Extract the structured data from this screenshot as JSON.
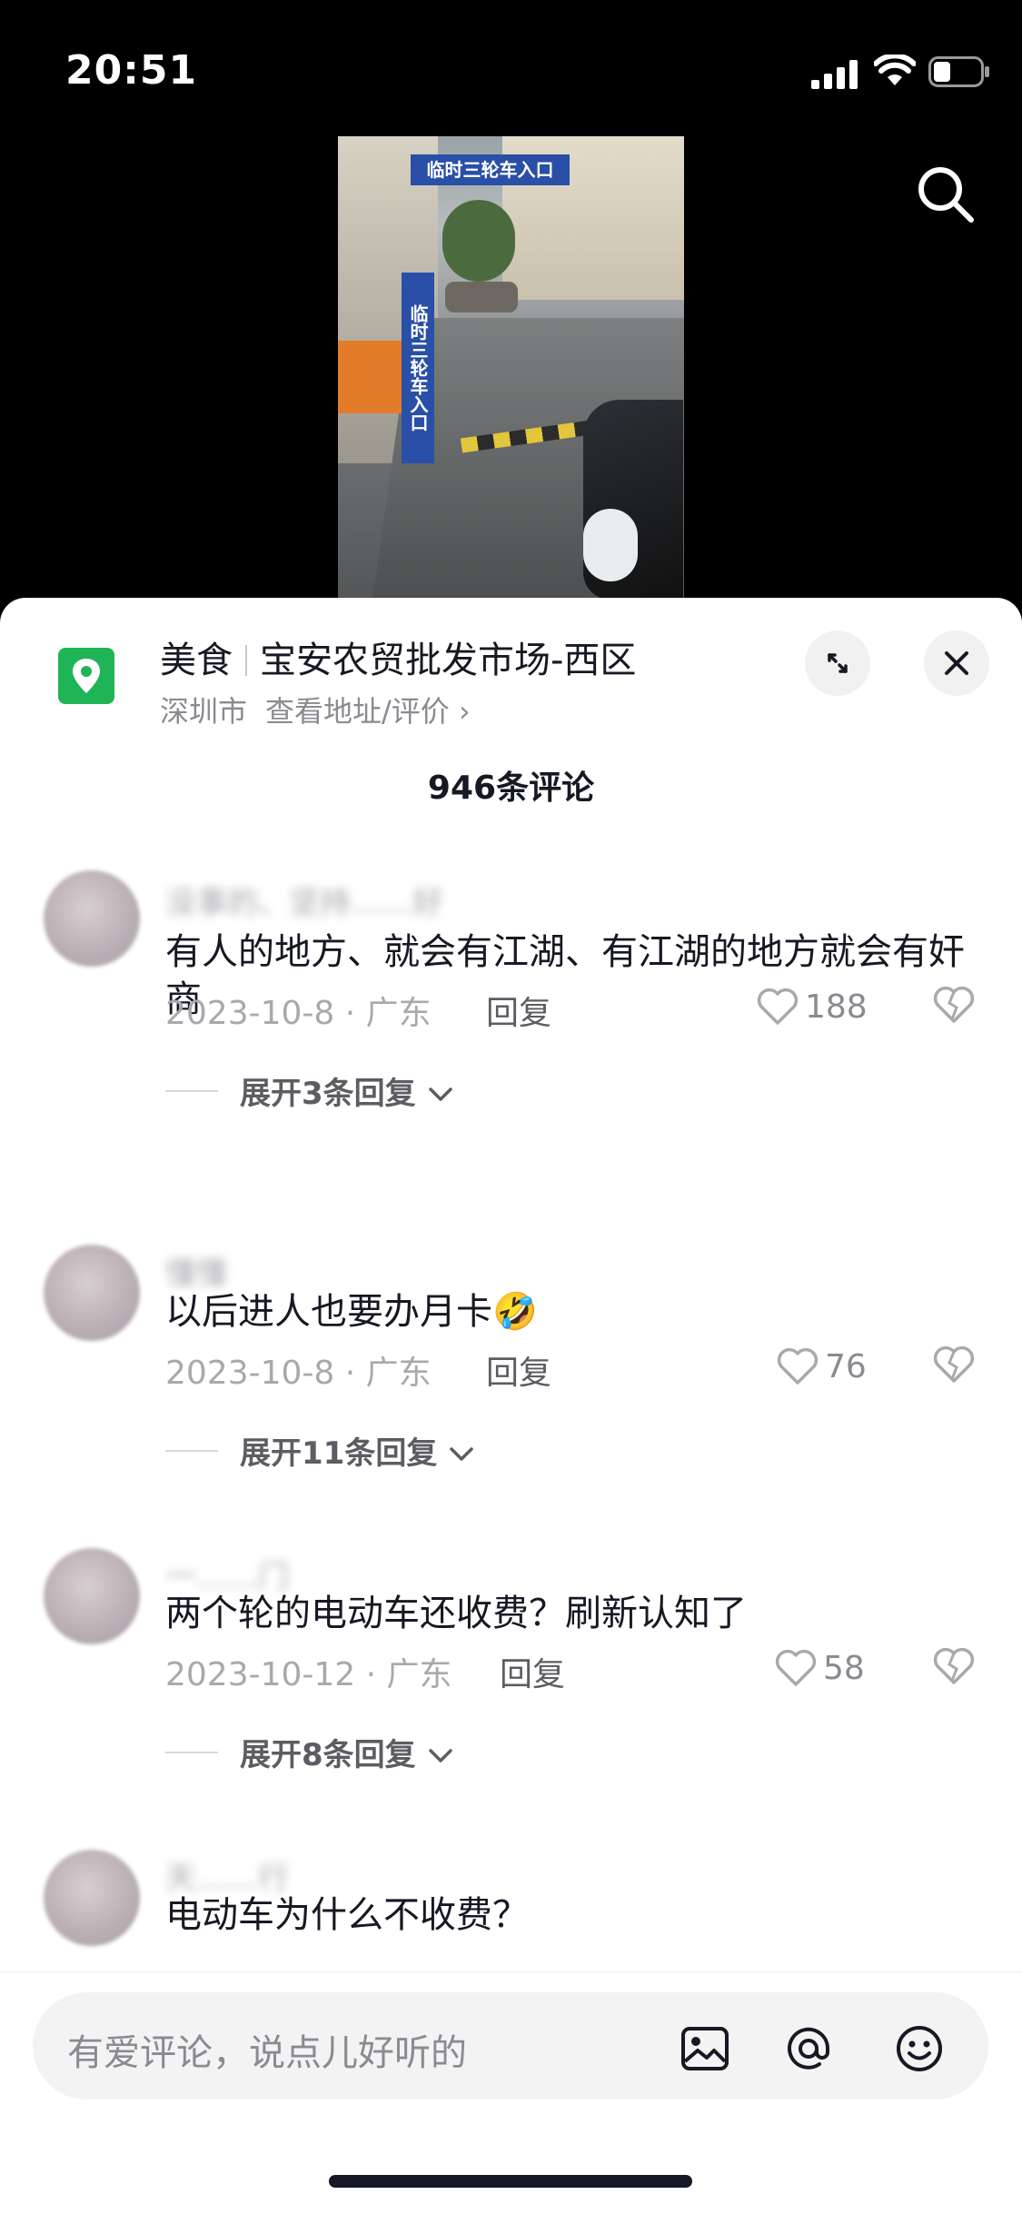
{
  "status": {
    "time": "20:51",
    "icons": [
      "signal-icon",
      "wifi-icon",
      "battery-icon"
    ]
  },
  "video": {
    "sign_text": "临时三轮车入口",
    "pole_text": "临时三轮车入口",
    "search_icon": "search-icon"
  },
  "poi": {
    "category": "美食",
    "name": "宝安农贸批发市场-西区",
    "city": "深圳市",
    "link": "查看地址/评价 ›",
    "icon": "location-pin-icon",
    "accent": "#1fb455"
  },
  "comments_header": {
    "count_label": "946条评论"
  },
  "comments": [
    {
      "username": "没事的、坚持……好",
      "text": "有人的地方、就会有江湖、有江湖的地方就会有奸商",
      "date": "2023-10-8 · 广东",
      "reply_label": "回复",
      "likes": "188",
      "expand_label": "展开3条回复"
    },
    {
      "username": "懂懂",
      "text": "以后进人也要办月卡🤣",
      "date": "2023-10-8 · 广东",
      "reply_label": "回复",
      "likes": "76",
      "expand_label": "展开11条回复"
    },
    {
      "username": "一……门",
      "text": "两个轮的电动车还收费？刷新认知了",
      "date": "2023-10-12 · 广东",
      "reply_label": "回复",
      "likes": "58",
      "expand_label": "展开8条回复"
    },
    {
      "username": "天……行",
      "text": "电动车为什么不收费？"
    }
  ],
  "input": {
    "placeholder": "有爱评论，说点儿好听的",
    "icons": [
      "image-icon",
      "at-icon",
      "emoji-icon"
    ]
  }
}
